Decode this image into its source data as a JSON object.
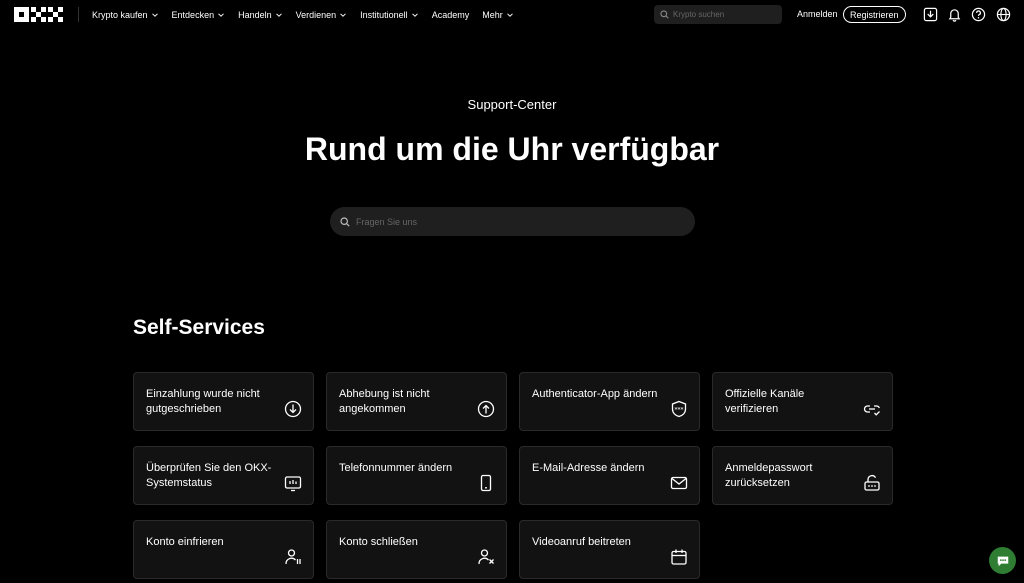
{
  "nav": {
    "logo_text": "OKX",
    "items": [
      {
        "label": "Krypto kaufen",
        "has_dropdown": true
      },
      {
        "label": "Entdecken",
        "has_dropdown": true
      },
      {
        "label": "Handeln",
        "has_dropdown": true
      },
      {
        "label": "Verdienen",
        "has_dropdown": true
      },
      {
        "label": "Institutionell",
        "has_dropdown": true
      },
      {
        "label": "Academy",
        "has_dropdown": false
      },
      {
        "label": "Mehr",
        "has_dropdown": true
      }
    ],
    "search_placeholder": "Krypto suchen",
    "login_label": "Anmelden",
    "register_label": "Registrieren",
    "icons": [
      "download-icon",
      "bell-icon",
      "help-icon",
      "globe-icon"
    ]
  },
  "hero": {
    "eyebrow": "Support-Center",
    "headline": "Rund um die Uhr verfügbar",
    "search_placeholder": "Fragen Sie uns"
  },
  "self_services": {
    "title": "Self-Services",
    "cards": [
      {
        "label": "Einzahlung wurde nicht gutgeschrieben",
        "icon": "deposit-icon"
      },
      {
        "label": "Abhebung ist nicht angekommen",
        "icon": "withdraw-icon"
      },
      {
        "label": "Authenticator-App ändern",
        "icon": "shield-icon"
      },
      {
        "label": "Offizielle Kanäle verifizieren",
        "icon": "link-check-icon"
      },
      {
        "label": "Überprüfen Sie den OKX-Systemstatus",
        "icon": "system-status-icon"
      },
      {
        "label": "Telefonnummer ändern",
        "icon": "phone-icon"
      },
      {
        "label": "E-Mail-Adresse ändern",
        "icon": "mail-icon"
      },
      {
        "label": "Anmeldepasswort zurücksetzen",
        "icon": "lock-reset-icon"
      },
      {
        "label": "Konto einfrieren",
        "icon": "user-freeze-icon"
      },
      {
        "label": "Konto schließen",
        "icon": "user-close-icon"
      },
      {
        "label": "Videoanruf beitreten",
        "icon": "calendar-icon"
      }
    ]
  },
  "colors": {
    "background": "#000000",
    "card_bg": "#121212",
    "card_border": "#2a2a2a",
    "input_bg": "#1f1f1f",
    "chat_green": "#2e7d32"
  }
}
